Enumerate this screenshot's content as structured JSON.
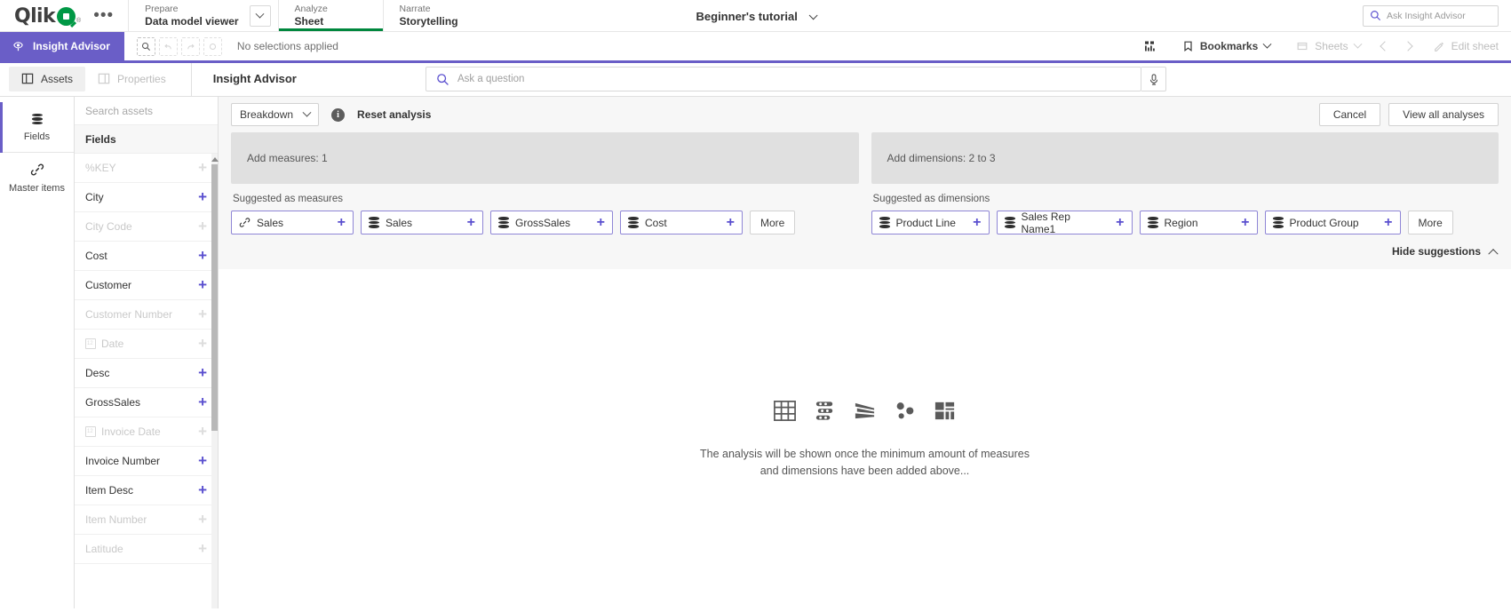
{
  "topbar": {
    "logo_text": "Qlik",
    "more_menu": "•••",
    "sections": [
      {
        "kicker": "Prepare",
        "title": "Data model viewer",
        "has_caret": true,
        "active": false
      },
      {
        "kicker": "Analyze",
        "title": "Sheet",
        "has_caret": false,
        "active": true
      },
      {
        "kicker": "Narrate",
        "title": "Storytelling",
        "has_caret": false,
        "active": false
      }
    ],
    "doc_title": "Beginner's tutorial",
    "ask_insight_advisor_placeholder": "Ask Insight Advisor"
  },
  "selection_bar": {
    "insight_advisor_label": "Insight Advisor",
    "no_selections_text": "No selections applied",
    "bookmarks_label": "Bookmarks",
    "sheets_label": "Sheets",
    "edit_sheet_label": "Edit sheet"
  },
  "subheader": {
    "assets_tab": "Assets",
    "properties_tab": "Properties",
    "heading": "Insight Advisor",
    "search_placeholder": "Ask a question"
  },
  "rail": {
    "items": [
      {
        "label": "Fields",
        "icon": "database-icon",
        "selected": true
      },
      {
        "label": "Master items",
        "icon": "link-icon",
        "selected": false
      }
    ]
  },
  "assets": {
    "search_placeholder": "Search assets",
    "group_title": "Fields",
    "fields": [
      {
        "name": "%KEY",
        "enabled": false,
        "icon": "none"
      },
      {
        "name": "City",
        "enabled": true,
        "icon": "none"
      },
      {
        "name": "City Code",
        "enabled": false,
        "icon": "none"
      },
      {
        "name": "Cost",
        "enabled": true,
        "icon": "none"
      },
      {
        "name": "Customer",
        "enabled": true,
        "icon": "none"
      },
      {
        "name": "Customer Number",
        "enabled": false,
        "icon": "none"
      },
      {
        "name": "Date",
        "enabled": false,
        "icon": "calendar-icon"
      },
      {
        "name": "Desc",
        "enabled": true,
        "icon": "none"
      },
      {
        "name": "GrossSales",
        "enabled": true,
        "icon": "none"
      },
      {
        "name": "Invoice Date",
        "enabled": false,
        "icon": "calendar-icon"
      },
      {
        "name": "Invoice Number",
        "enabled": true,
        "icon": "none"
      },
      {
        "name": "Item Desc",
        "enabled": true,
        "icon": "none"
      },
      {
        "name": "Item Number",
        "enabled": false,
        "icon": "none"
      },
      {
        "name": "Latitude",
        "enabled": false,
        "icon": "none"
      }
    ]
  },
  "toolbar": {
    "breakdown_label": "Breakdown",
    "reset_label": "Reset analysis",
    "cancel_label": "Cancel",
    "view_all_label": "View all analyses"
  },
  "measures_panel": {
    "dropzone_text": "Add measures: 1",
    "suggested_label": "Suggested as measures",
    "chips": [
      {
        "label": "Sales",
        "icon": "link-icon"
      },
      {
        "label": "Sales",
        "icon": "database-icon"
      },
      {
        "label": "GrossSales",
        "icon": "database-icon"
      },
      {
        "label": "Cost",
        "icon": "database-icon"
      }
    ],
    "more_label": "More"
  },
  "dimensions_panel": {
    "dropzone_text": "Add dimensions: 2 to 3",
    "suggested_label": "Suggested as dimensions",
    "chips": [
      {
        "label": "Product Line",
        "icon": "database-icon"
      },
      {
        "label": "Sales Rep Name1",
        "icon": "database-icon"
      },
      {
        "label": "Region",
        "icon": "database-icon"
      },
      {
        "label": "Product Group",
        "icon": "database-icon"
      }
    ],
    "more_label": "More"
  },
  "suggestions_toggle": {
    "label": "Hide suggestions"
  },
  "empty_state": {
    "line1": "The analysis will be shown once the minimum amount of measures",
    "line2": "and dimensions have been added above...",
    "icons": [
      "table-chart-icon",
      "bar-chart-icon",
      "funnel-chart-icon",
      "scatter-chart-icon",
      "treemap-chart-icon"
    ]
  },
  "colors": {
    "accent_purple": "#6a5ec7",
    "qlik_green": "#009845",
    "analyze_underline": "#00873d",
    "chip_border": "#8f86d6",
    "dropzone_bg": "#e0e0e0"
  }
}
